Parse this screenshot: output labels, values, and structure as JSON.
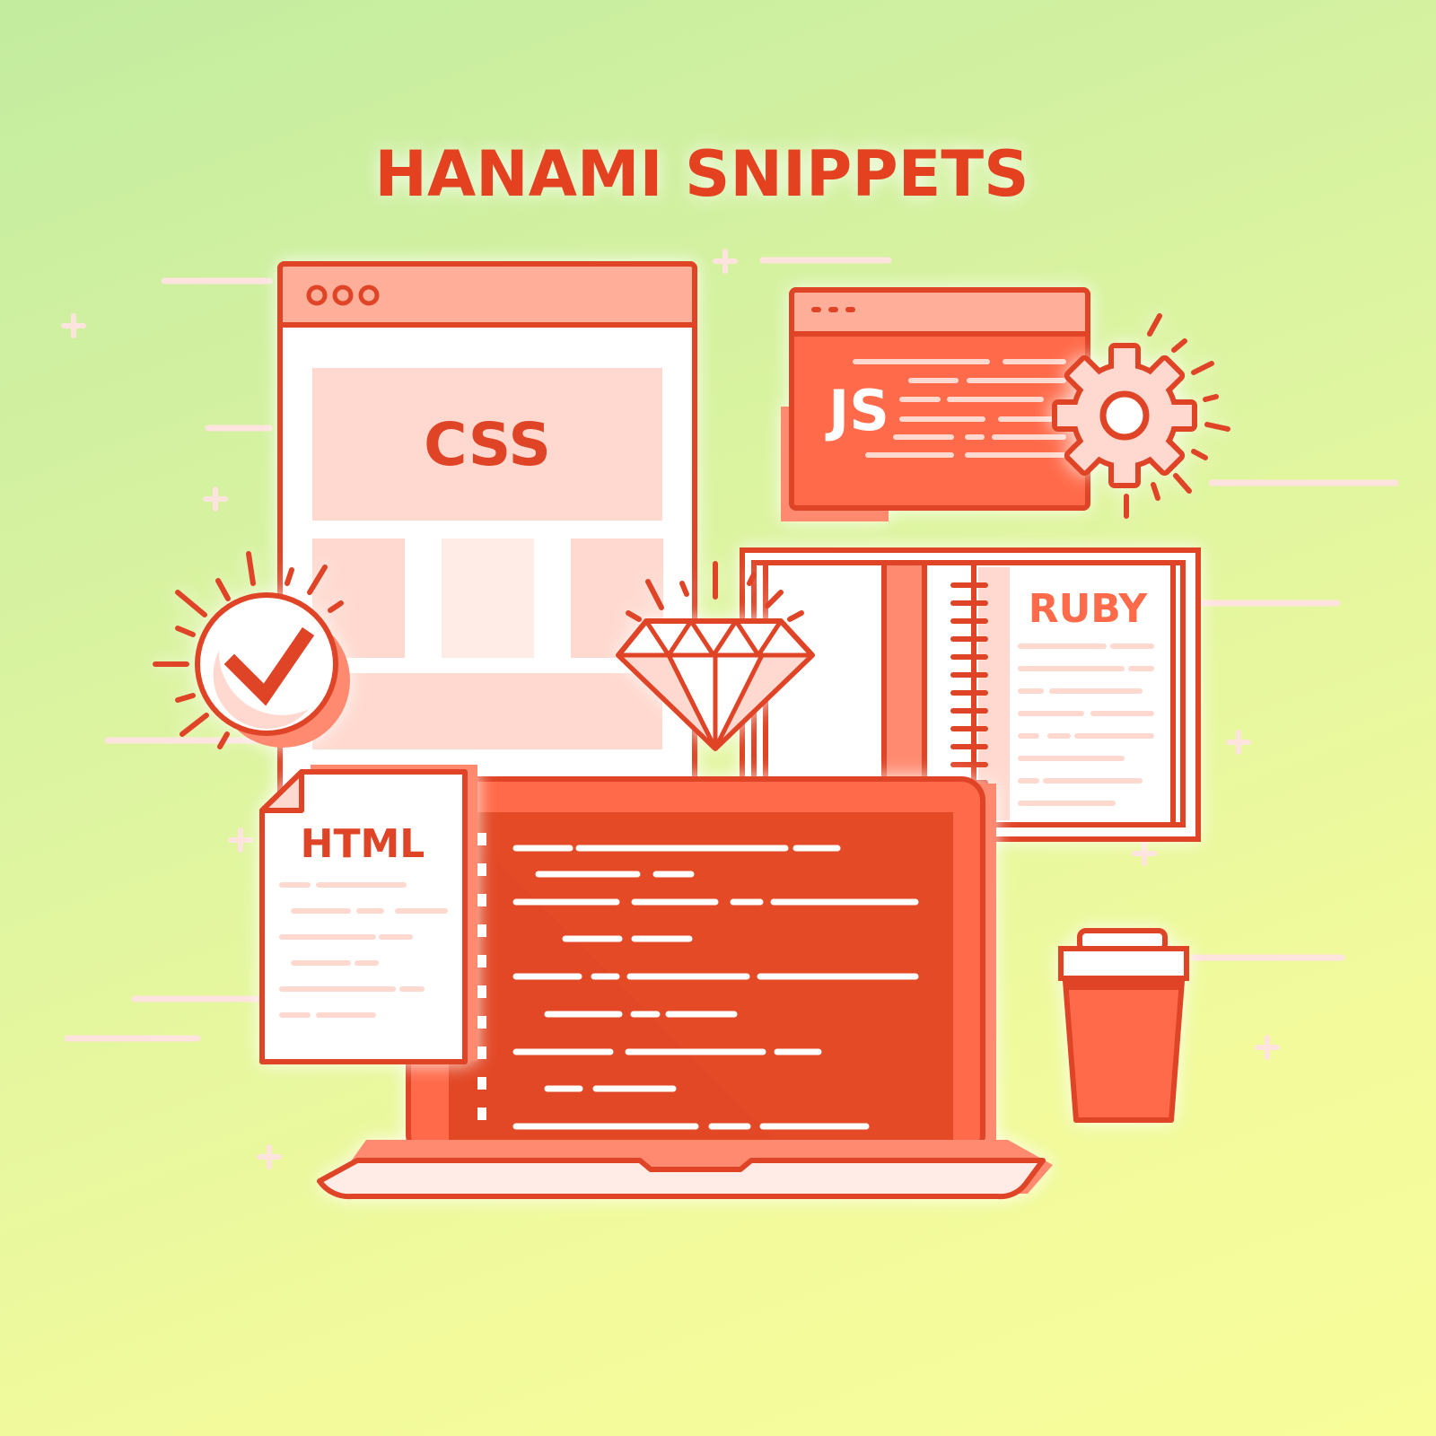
{
  "title": "HANAMI SNIPPETS",
  "labels": {
    "css": "CSS",
    "js": "JS",
    "ruby": "RUBY",
    "html": "HTML"
  },
  "colors": {
    "outline": "#e04427",
    "primary": "#ff6b4a",
    "dark": "#e34a25",
    "light": "#ffd9cf",
    "lighter": "#ffece6",
    "header": "#ffae99",
    "white": "#ffffff",
    "bg_top": "#c3ec9f",
    "bg_bottom": "#f8fd9a"
  },
  "icons": [
    "check-circle-icon",
    "diamond-icon",
    "gear-icon",
    "coffee-cup-icon",
    "laptop-icon",
    "document-icon",
    "notebook-icon",
    "browser-window-icon"
  ]
}
